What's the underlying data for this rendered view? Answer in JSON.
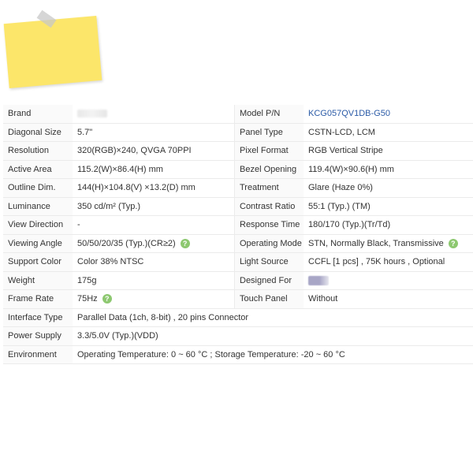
{
  "colors": {
    "sticky_note": "#fce66a",
    "link": "#2b5ba7",
    "help_icon": "#8dc870"
  },
  "icons": {
    "help": "?"
  },
  "specs": {
    "brand_label": "Brand",
    "model_label": "Model P/N",
    "model_value": "KCG057QV1DB-G50",
    "diagonal_label": "Diagonal Size",
    "diagonal_value": "5.7\"",
    "panel_type_label": "Panel Type",
    "panel_type_value": "CSTN-LCD, LCM",
    "resolution_label": "Resolution",
    "resolution_value": "320(RGB)×240,  QVGA  70PPI",
    "pixel_format_label": "Pixel Format",
    "pixel_format_value": "RGB Vertical Stripe",
    "active_area_label": "Active Area",
    "active_area_value": "115.2(W)×86.4(H) mm",
    "bezel_label": "Bezel Opening",
    "bezel_value": "119.4(W)×90.6(H) mm",
    "outline_label": "Outline Dim.",
    "outline_value": "144(H)×104.8(V) ×13.2(D) mm",
    "treatment_label": "Treatment",
    "treatment_value": "Glare (Haze 0%)",
    "luminance_label": "Luminance",
    "luminance_value": "350 cd/m² (Typ.)",
    "contrast_label": "Contrast Ratio",
    "contrast_value": "55:1 (Typ.) (TM)",
    "view_dir_label": "View Direction",
    "view_dir_value": "-",
    "response_label": "Response Time",
    "response_value": "180/170 (Typ.)(Tr/Td)",
    "viewing_angle_label": "Viewing Angle",
    "viewing_angle_value": "50/50/20/35 (Typ.)(CR≥2)",
    "op_mode_label": "Operating Mode",
    "op_mode_value": "STN, Normally Black, Transmissive",
    "support_color_label": "Support Color",
    "support_color_value": "Color   38% NTSC",
    "light_source_label": "Light Source",
    "light_source_value": "CCFL  [1 pcs] , 75K hours , Optional",
    "weight_label": "Weight",
    "weight_value": "175g",
    "designed_for_label": "Designed For",
    "frame_rate_label": "Frame Rate",
    "frame_rate_value": "75Hz",
    "touch_label": "Touch Panel",
    "touch_value": "Without",
    "interface_label": "Interface Type",
    "interface_value": "Parallel Data (1ch, 8-bit) , 20 pins Connector",
    "power_label": "Power Supply",
    "power_value": "3.3/5.0V (Typ.)(VDD)",
    "env_label": "Environment",
    "env_value": "Operating Temperature: 0 ~ 60 °C ; Storage Temperature: -20 ~ 60 °C"
  }
}
